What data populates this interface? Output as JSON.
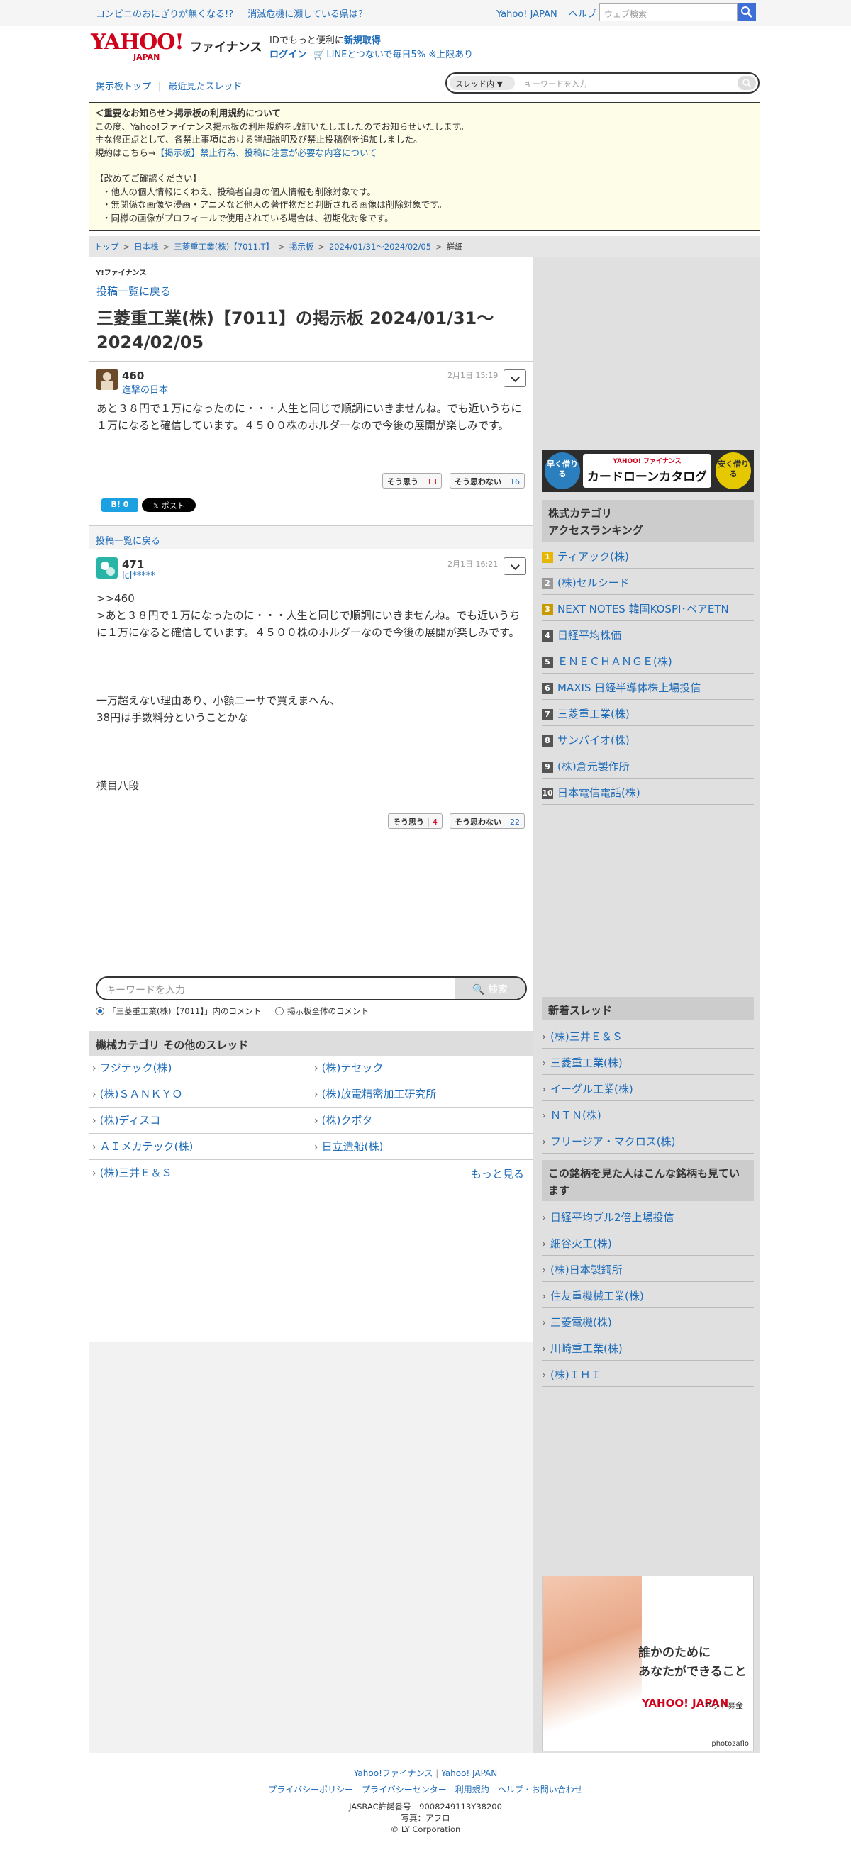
{
  "topbar": {
    "left_links": [
      "コンビニのおにぎりが無くなる!?",
      "消滅危機に瀕している県は？"
    ],
    "right_links": [
      "Yahoo! JAPAN",
      "ヘルプ"
    ],
    "search_placeholder": "ウェブ検索"
  },
  "header": {
    "logo_text": "YAHOO!",
    "logo_sub": "JAPAN",
    "service": "ファイナンス",
    "id_text": "IDでもっと便利に",
    "id_link": "新規取得",
    "login": "ログイン",
    "line_promo": "LINEとつないで毎日5% ※上限あり"
  },
  "nav": {
    "board_top": "掲示板トップ",
    "recent": "最近見たスレッド",
    "scope": "スレッド内",
    "search_placeholder": "キーワードを入力"
  },
  "notice": {
    "heading": "＜重要なお知らせ＞掲示板の利用規約について",
    "lines": [
      "この度、Yahoo!ファイナンス掲示板の利用規約を改訂いたしましたのでお知らせいたします。",
      "主な修正点として、各禁止事項における詳細説明及び禁止投稿例を追加しました。"
    ],
    "rule_prefix": "規約はこちら→",
    "rule_link": "【掲示板】禁止行為、投稿に注意が必要な内容について",
    "check_heading": "【改めてご確認ください】",
    "bullets": [
      "・他人の個人情報にくわえ、投稿者自身の個人情報も削除対象です。",
      "・無関係な画像や漫画・アニメなど他人の著作物だと判断される画像は削除対象です。",
      "・同様の画像がプロフィールで使用されている場合は、初期化対象です。"
    ]
  },
  "breadcrumb": [
    "トップ",
    "日本株",
    "三菱重工業(株)【7011.T】",
    "掲示板",
    "2024/01/31～2024/02/05",
    "詳細"
  ],
  "post": {
    "small_logo": "Y!ファイナンス",
    "back_link": "投稿一覧に戻る",
    "title": "三菱重工業(株)【7011】の掲示板 2024/01/31～2024/02/05"
  },
  "comments": [
    {
      "num": "460",
      "user": "進撃の日本",
      "date": "2月1日 15:19",
      "body": "あと３８円で１万になったのに・・・人生と同じで順調にいきませんね。でも近いうちに１万になると確信しています。４５００株のホルダーなので今後の展開が楽しみです。",
      "agree_label": "そう思う",
      "agree": "13",
      "disagree_label": "そう思わない",
      "disagree": "16"
    },
    {
      "num": "471",
      "user": "lcl*****",
      "date": "2月1日 16:21",
      "body": ">>460\n>あと３８円で１万になったのに・・・人生と同じで順調にいきませんね。でも近いうちに１万になると確信しています。４５００株のホルダーなので今後の展開が楽しみです。\n\n\n\n一万超えない理由あり、小額ニーサで買えまへん、\n38円は手数料分ということかな\n\n\n\n横目八段",
      "agree_label": "そう思う",
      "agree": "4",
      "disagree_label": "そう思わない",
      "disagree": "22"
    }
  ],
  "share": {
    "hatena": "B! 0",
    "x": "𝕏 ポスト"
  },
  "bottom_search": {
    "placeholder": "キーワードを入力",
    "button": "検索",
    "option1": "「三菱重工業(株)【7011】」内のコメント",
    "option2": "掲示板全体のコメント"
  },
  "other_threads": {
    "heading": "機械カテゴリ その他のスレッド",
    "items": [
      "フジテック(株)",
      "(株)テセック",
      "(株)ＳＡＮＫＹＯ",
      "(株)放電精密加工研究所",
      "(株)ディスコ",
      "(株)クボタ",
      "ＡＩメカテック(株)",
      "日立造船(株)",
      "(株)三井Ｅ＆Ｓ"
    ],
    "more": "もっと見る"
  },
  "sidebar": {
    "ad1": {
      "left": "早く借りる",
      "yahoo": "YAHOO! ファイナンス",
      "title": "カードローンカタログ",
      "right": "安く借りる"
    },
    "ranking_heading": "株式カテゴリ\nアクセスランキング",
    "ranking": [
      "ティアック(株)",
      "(株)セルシード",
      "NEXT NOTES 韓国KOSPI･ベアETN",
      "日経平均株価",
      "ＥＮＥＣＨＡＮＧＥ(株)",
      "MAXIS 日経半導体株上場投信",
      "三菱重工業(株)",
      "サンバイオ(株)",
      "(株)倉元製作所",
      "日本電信電話(株)"
    ],
    "ranking_colors": [
      "#e5b700",
      "#999999",
      "#c79a00",
      "#555555",
      "#555555",
      "#555555",
      "#555555",
      "#555555",
      "#555555",
      "#555555"
    ],
    "new_heading": "新着スレッド",
    "new_threads": [
      "(株)三井Ｅ＆Ｓ",
      "三菱重工業(株)",
      "イーグル工業(株)",
      "ＮＴＮ(株)",
      "フリージア・マクロス(株)"
    ],
    "also_heading": "この銘柄を見た人はこんな銘柄も見ています",
    "also": [
      "日経平均ブル2倍上場投信",
      "細谷火工(株)",
      "(株)日本製鋼所",
      "住友重機械工業(株)",
      "三菱電機(株)",
      "川崎重工業(株)",
      "(株)ＩＨＩ"
    ],
    "ad2": {
      "line1": "誰かのために",
      "line2": "あなたができること",
      "yahoo": "YAHOO! JAPAN",
      "sub": "ネット募金",
      "credit": "photozaflo"
    }
  },
  "footer": {
    "row1": [
      "Yahoo!ファイナンス",
      "Yahoo! JAPAN"
    ],
    "row2": [
      "プライバシーポリシー",
      "プライバシーセンター",
      "利用規約",
      "ヘルプ・お問い合わせ"
    ],
    "jasrac": "JASRAC許諾番号：9008249113Y38200",
    "photo": "写真：アフロ",
    "copyright": "© LY Corporation"
  }
}
